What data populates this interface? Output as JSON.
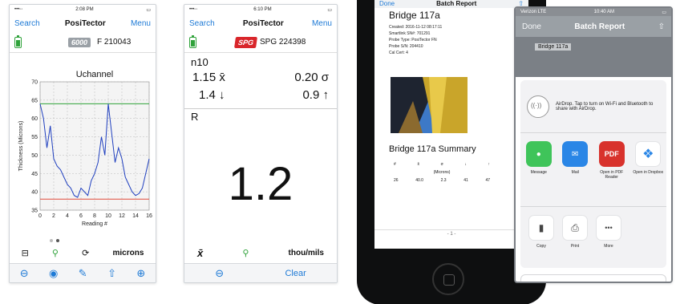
{
  "phone1": {
    "status_time": "2:08 PM",
    "nav_left": "Search",
    "nav_title": "PosiTector",
    "nav_right": "Menu",
    "badge": "6000",
    "serial": "F 210043",
    "units": "microns",
    "toolbar_icons": [
      "minus-circle-icon",
      "camera-icon",
      "edit-icon",
      "share-icon",
      "plus-circle-icon"
    ]
  },
  "phone2": {
    "status_time": "6:10 PM",
    "nav_left": "Search",
    "nav_title": "PosiTector",
    "nav_right": "Menu",
    "badge": "SPG",
    "serial": "SPG 224398",
    "n_label": "n10",
    "mean": "1.15",
    "mean_symbol": "x̄",
    "sigma": "0.20",
    "sigma_symbol": "σ",
    "min": "1.4",
    "min_symbol": "↓",
    "max": "0.9",
    "max_symbol": "↑",
    "section": "R",
    "reading": "1.2",
    "units": "thou/mils",
    "bottom_left_symbol": "x̄",
    "toolbar_clear": "Clear"
  },
  "device": {
    "nav_left": "Done",
    "nav_title": "Batch Report",
    "doc_title": "Bridge 117a",
    "meta": [
      "Created: 2016-11-12 08:17:11",
      "Smartlink SN#: 701291",
      "Probe Type: PosiTector FN",
      "Probe S/N: 204410",
      "Cal Cert: 4"
    ],
    "summary_title": "Bridge 117a Summary",
    "summary_headers": [
      "#",
      "x̄",
      "σ",
      "↓",
      "↑"
    ],
    "summary_units": "(Microns)",
    "summary_values": [
      "26",
      "40.0",
      "2.3",
      "41",
      "47"
    ],
    "page": "- 1 -"
  },
  "phone3": {
    "status_carrier": "Verizon LTE",
    "status_time": "10:40 AM",
    "nav_left": "Done",
    "nav_title": "Batch Report",
    "doc_strip": "Bridge 117a",
    "airdrop_text": "AirDrop. Tap to turn on Wi-Fi and Bluetooth to share with AirDrop.",
    "apps": [
      {
        "label": "Message",
        "icon": "message-icon",
        "color": "#3fc45a",
        "glyph": "●"
      },
      {
        "label": "Mail",
        "icon": "mail-icon",
        "color": "#2a86e6",
        "glyph": "✉"
      },
      {
        "label": "Open in PDF Reader",
        "icon": "pdf-icon",
        "color": "#d8322c",
        "glyph": "PDF"
      },
      {
        "label": "Open in Dropbox",
        "icon": "dropbox-icon",
        "color": "#ffffff",
        "glyph": "❖"
      }
    ],
    "actions": [
      {
        "label": "Copy",
        "icon": "copy-icon",
        "glyph": "▮"
      },
      {
        "label": "Print",
        "icon": "print-icon",
        "glyph": "⎙"
      },
      {
        "label": "More",
        "icon": "more-icon",
        "glyph": "•••"
      }
    ],
    "cancel": "Cancel"
  },
  "chart_data": {
    "type": "line",
    "title": "Uchannel",
    "xlabel": "Reading #",
    "ylabel": "Thickness (Microns)",
    "xlim": [
      0,
      16
    ],
    "ylim": [
      35,
      70
    ],
    "xticks": [
      0,
      2,
      4,
      6,
      8,
      10,
      12,
      14,
      16
    ],
    "yticks": [
      35,
      40,
      45,
      50,
      55,
      60,
      65,
      70
    ],
    "series": [
      {
        "x": [
          0,
          0.5,
          1,
          1.5,
          2,
          2.5,
          3,
          3.5,
          4,
          4.5,
          5,
          5.5,
          6,
          6.5,
          7,
          7.5,
          8,
          8.5,
          9,
          9.5,
          10,
          10.5,
          11,
          11.5,
          12,
          12.5,
          13,
          13.5,
          14,
          14.5,
          15,
          15.5,
          16
        ],
        "y": [
          64,
          60,
          52,
          58,
          49,
          47,
          46,
          44,
          42,
          41,
          39,
          38.5,
          41,
          40,
          39,
          43,
          45,
          48,
          55,
          50,
          64,
          56,
          48,
          52,
          49,
          44,
          42,
          40,
          39,
          39.5,
          41,
          45,
          49
        ],
        "color": "#1f3fbf"
      }
    ],
    "reference_lines": [
      {
        "y": 64,
        "color": "#2fa23a"
      },
      {
        "y": 38,
        "color": "#e24b3b"
      }
    ],
    "grid": true
  }
}
